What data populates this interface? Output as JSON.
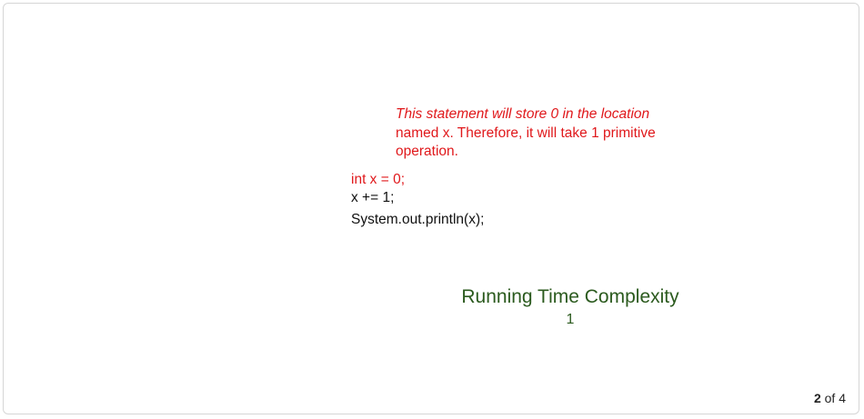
{
  "annotation": {
    "italic_text": "This statement will store 0 in the location",
    "rest_text": "named x. Therefore, it will take 1 primitive operation."
  },
  "code": {
    "lines": [
      "int x = 0;",
      "x += 1;",
      "System.out.println(x);"
    ],
    "highlight_color": "#e0181b"
  },
  "complexity": {
    "title": "Running Time Complexity",
    "value": "1",
    "color": "#2b5a1e"
  },
  "pager": {
    "current": "2",
    "separator": "of",
    "total": "4"
  }
}
